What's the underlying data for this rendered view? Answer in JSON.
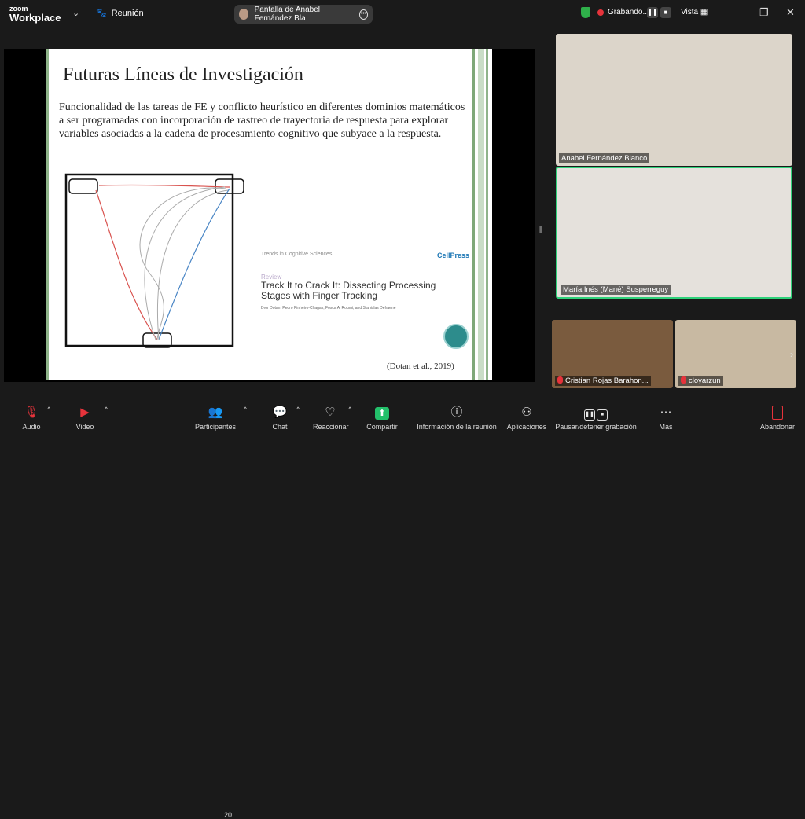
{
  "header": {
    "logo_line1": "zoom",
    "logo_line2": "Workplace",
    "meeting_label": "Reunión",
    "share_label": "Pantalla de Anabel Fernández Bla",
    "recording_label": "Grabando...",
    "view_label": "Vista"
  },
  "slide": {
    "title": "Futuras Líneas de Investigación",
    "body": "Funcionalidad de las tareas de FE y conflicto heurístico en diferentes dominios matemáticos a ser programadas con incorporación de rastreo de trayectoria de respuesta para explorar variables asociadas a la cadena de procesamiento cognitivo que subyace a la respuesta.",
    "paper_journal": "Trends in Cognitive Sciences",
    "paper_publisher": "CellPress",
    "paper_type": "Review",
    "paper_title": "Track It to Crack It: Dissecting Processing Stages with Finger Tracking",
    "paper_authors": "Dror Dotan, Pedro Pinheiro-Chagas, Fosca Al Roumi, and Stanislas Dehaene",
    "citation": "(Dotan et al., 2019)",
    "curve_colors": {
      "red": "#d9534f",
      "blue": "#4a86c5",
      "gray": "#aaaaaa"
    }
  },
  "participants": [
    {
      "name": "Anabel Fernández Blanco",
      "muted": false
    },
    {
      "name": "María Inés (Mané) Susperreguy",
      "muted": false,
      "speaking": true
    },
    {
      "name": "Cristian Rojas Barahon...",
      "muted": true
    },
    {
      "name": "cloyarzun",
      "muted": true
    }
  ],
  "toolbar": {
    "audio": "Audio",
    "video": "Video",
    "participants": "Participantes",
    "participants_count": "20",
    "chat": "Chat",
    "react": "Reaccionar",
    "share": "Compartir",
    "info": "Información de la reunión",
    "apps": "Aplicaciones",
    "record": "Pausar/detener grabación",
    "more": "Más",
    "leave": "Abandonar"
  },
  "colors": {
    "accent_green": "#23c06a",
    "speaking_border": "#2ed17a",
    "record_red": "#e6333b"
  }
}
